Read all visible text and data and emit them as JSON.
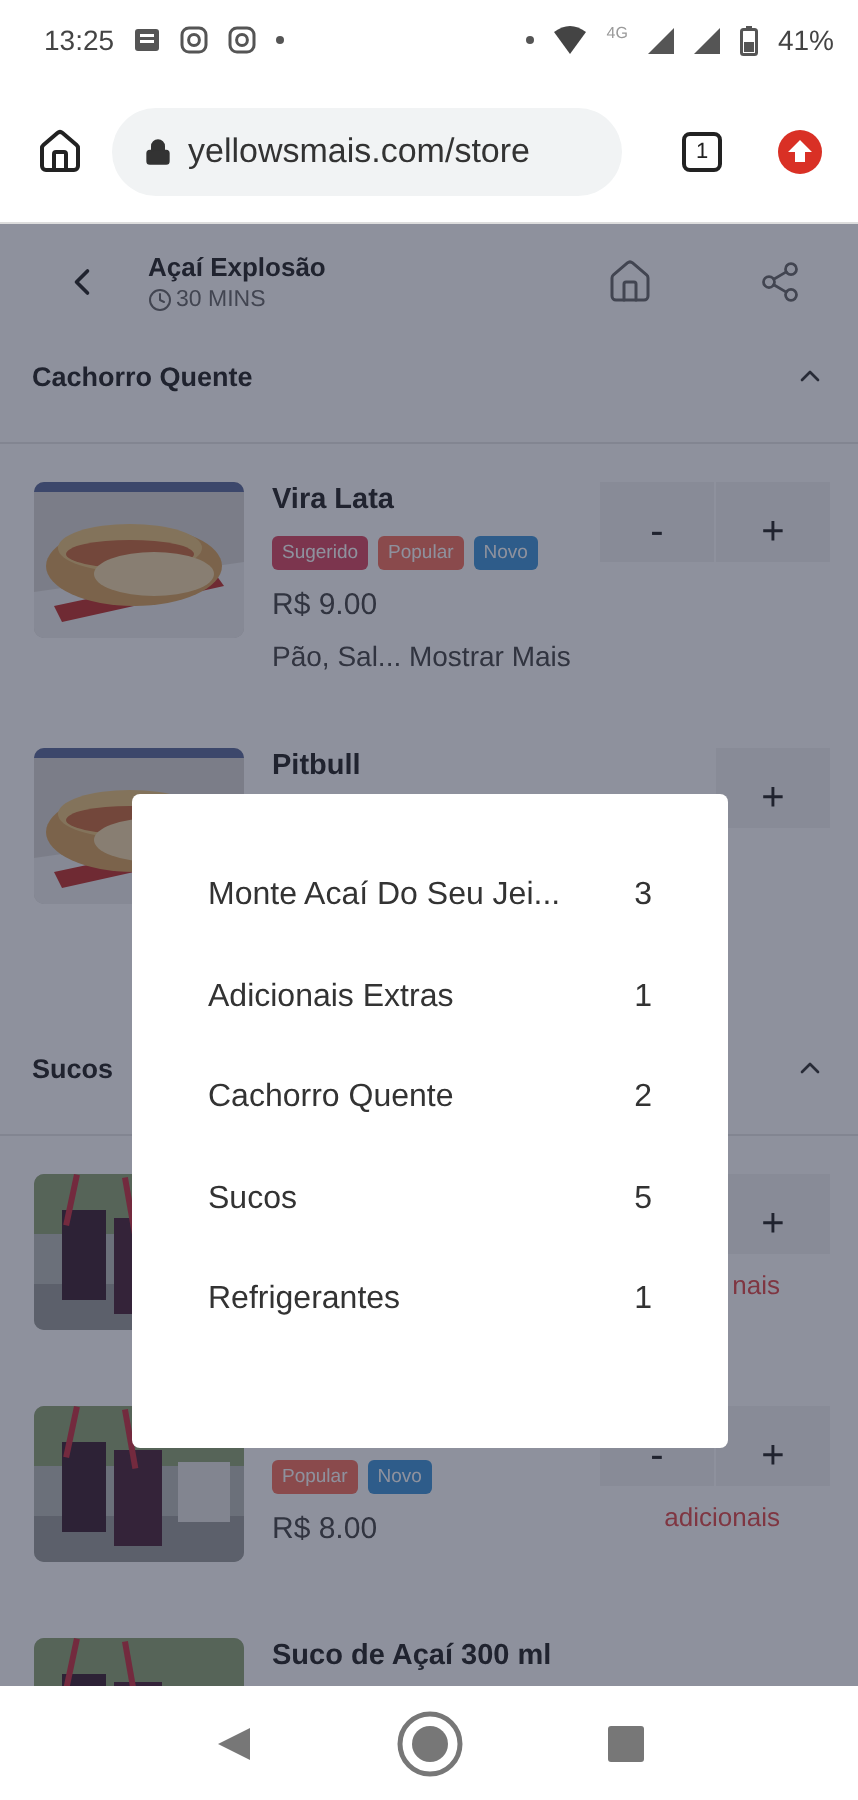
{
  "status_bar": {
    "time": "13:25",
    "network": "4G",
    "battery": "41%"
  },
  "browser": {
    "url": "yellowsmais.com/store",
    "tab_count": "1"
  },
  "store": {
    "name": "Açaí Explosão",
    "delivery_time": "30 MINS"
  },
  "sections": [
    {
      "title": "Cachorro Quente",
      "expanded": true,
      "items": [
        {
          "name": "Vira Lata",
          "tags": [
            {
              "label": "Sugerido",
              "color": "#7c354e"
            },
            {
              "label": "Popular",
              "color": "#8a4a4c"
            },
            {
              "label": "Novo",
              "color": "#2e5c8a"
            }
          ],
          "price": "R$ 9.00",
          "description": "Pão, Sal...",
          "more_link": "Mostrar Mais",
          "buttons": [
            "-",
            "+"
          ]
        },
        {
          "name": "Pitbull",
          "buttons": [
            "+"
          ]
        }
      ]
    },
    {
      "title": "Sucos",
      "expanded": true,
      "items": [
        {
          "buttons": [
            "+"
          ],
          "note": "nais"
        },
        {
          "tags": [
            {
              "label": "Popular",
              "color": "#8a4a4c"
            },
            {
              "label": "Novo",
              "color": "#2e5c8a"
            }
          ],
          "price": "R$ 8.00",
          "buttons": [
            "-",
            "+"
          ],
          "note": "adicionais"
        },
        {
          "name": "Suco de Açaí 300 ml"
        }
      ]
    }
  ],
  "category_menu": [
    {
      "label": "Monte Acaí Do Seu Jei...",
      "count": "3"
    },
    {
      "label": "Adicionais Extras",
      "count": "1"
    },
    {
      "label": "Cachorro Quente",
      "count": "2"
    },
    {
      "label": "Sucos",
      "count": "5"
    },
    {
      "label": "Refrigerantes",
      "count": "1"
    }
  ]
}
